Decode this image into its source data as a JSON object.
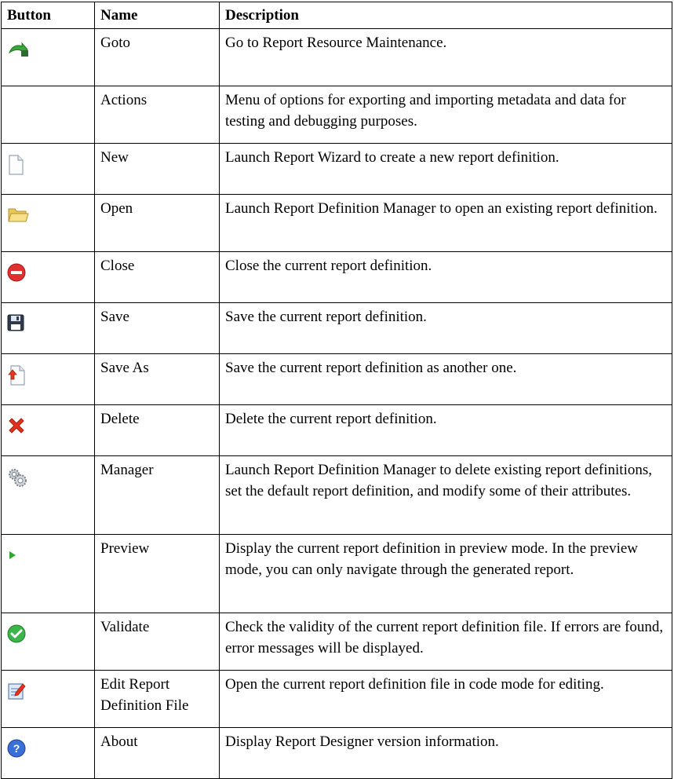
{
  "headers": {
    "button": "Button",
    "name": "Name",
    "description": "Description"
  },
  "rows": [
    {
      "icon": "goto-arrow-icon",
      "name": "Goto",
      "description": "Go to Report Resource Maintenance."
    },
    {
      "icon": "",
      "name": "Actions",
      "description": "Menu of options for exporting and importing metadata and data for testing and debugging purposes."
    },
    {
      "icon": "new-document-icon",
      "name": "New",
      "description": "Launch Report Wizard to create a new report definition."
    },
    {
      "icon": "open-folder-icon",
      "name": "Open",
      "description": "Launch Report Definition Manager to open an existing report definition."
    },
    {
      "icon": "close-icon",
      "name": "Close",
      "description": "Close the current report definition."
    },
    {
      "icon": "save-icon",
      "name": "Save",
      "description": "Save the current report definition."
    },
    {
      "icon": "save-as-icon",
      "name": "Save As",
      "description": "Save the current report definition as another one."
    },
    {
      "icon": "delete-icon",
      "name": "Delete",
      "description": "Delete the current report definition."
    },
    {
      "icon": "gears-icon",
      "name": "Manager",
      "description": "Launch Report Definition Manager to delete existing report definitions, set the default report definition, and modify some of their attributes."
    },
    {
      "icon": "play-icon",
      "name": "Preview",
      "description": "Display the current report definition in preview mode. In the preview mode, you can only navigate through the generated report."
    },
    {
      "icon": "validate-check-icon",
      "name": "Validate",
      "description": "Check the validity of the current report definition file. If errors are found, error messages will be displayed."
    },
    {
      "icon": "edit-file-icon",
      "name": "Edit Report Definition File",
      "description": "Open the current report definition file in code mode for editing."
    },
    {
      "icon": "help-icon",
      "name": "About",
      "description": "Display Report Designer version information."
    }
  ]
}
